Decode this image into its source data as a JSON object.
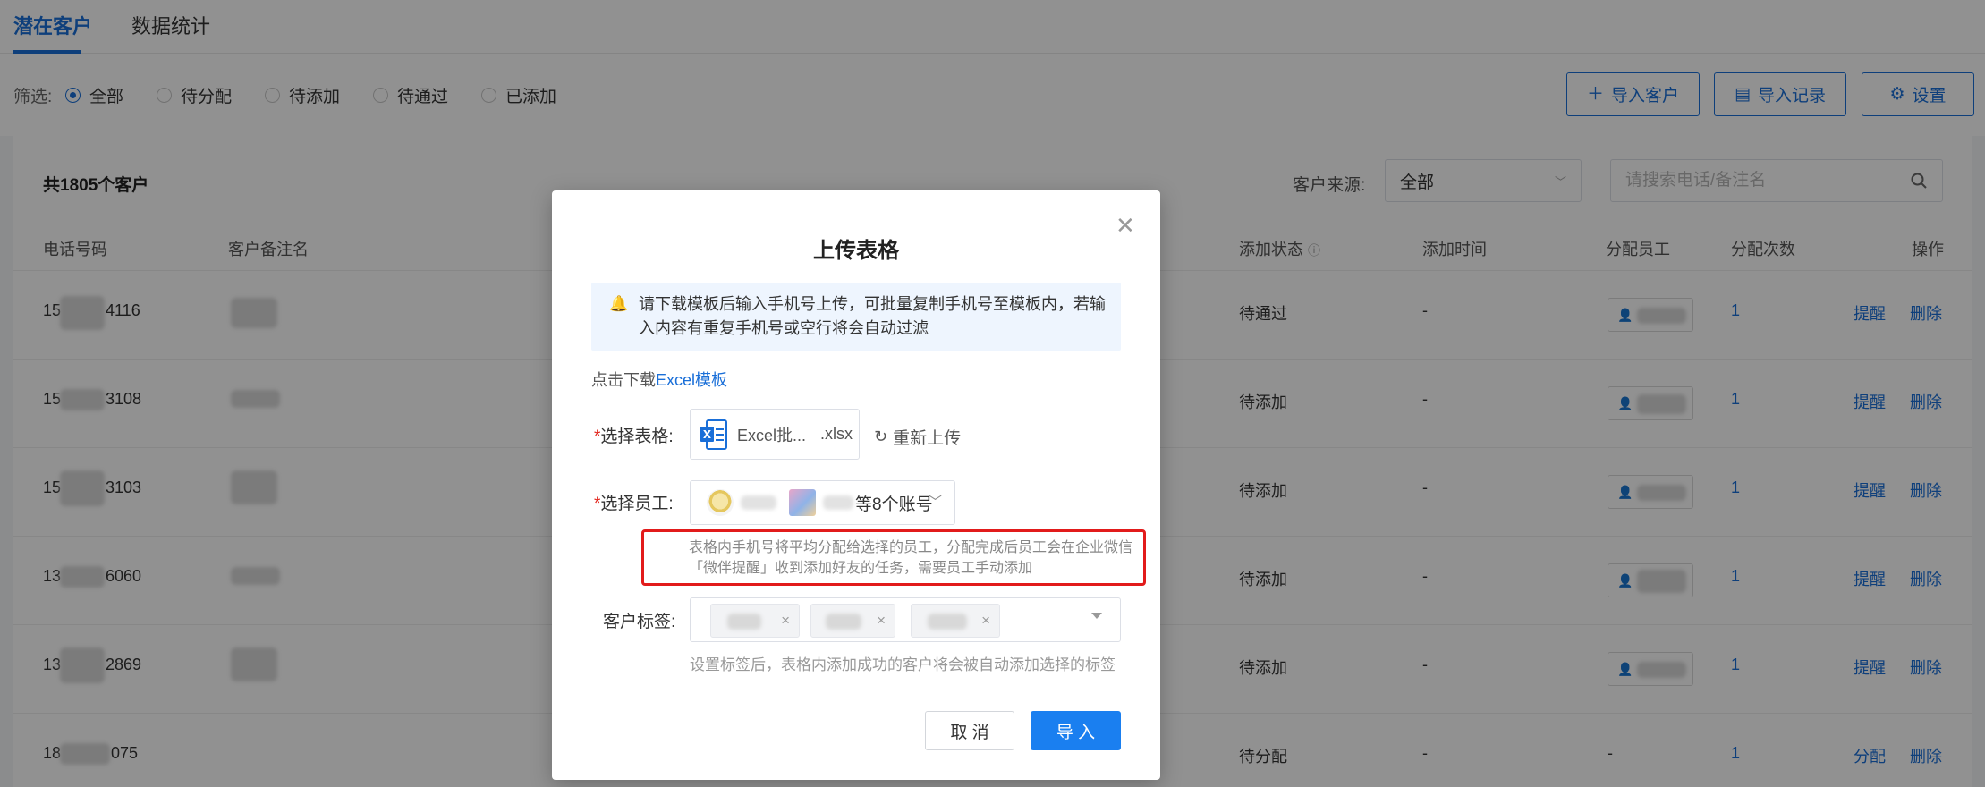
{
  "tabs": [
    {
      "label": "潜在客户",
      "active": true
    },
    {
      "label": "数据统计",
      "active": false
    }
  ],
  "filter": {
    "label": "筛选:",
    "options": [
      "全部",
      "待分配",
      "待添加",
      "待通过",
      "已添加"
    ],
    "selected": "全部"
  },
  "actions": {
    "import_customers": "导入客户",
    "import_records": "导入记录",
    "settings": "设置"
  },
  "list": {
    "count_text": "共1805个客户",
    "source_label": "客户来源:",
    "source_value": "全部",
    "search_placeholder": "请搜索电话/备注名"
  },
  "table": {
    "headers": {
      "phone": "电话号码",
      "remark": "客户备注名",
      "status": "添加状态",
      "time": "添加时间",
      "staff": "分配员工",
      "times": "分配次数",
      "ops": "操作"
    },
    "rows": [
      {
        "phone_head": "15",
        "phone_tail": "4116",
        "status": "待通过",
        "time": "-",
        "times": "1",
        "action": "提醒",
        "delete": "删除",
        "has_staff": true
      },
      {
        "phone_head": "15",
        "phone_tail": "3108",
        "status": "待添加",
        "time": "-",
        "times": "1",
        "action": "提醒",
        "delete": "删除",
        "has_staff": true
      },
      {
        "phone_head": "15",
        "phone_tail": "3103",
        "status": "待添加",
        "time": "-",
        "times": "1",
        "action": "提醒",
        "delete": "删除",
        "has_staff": true
      },
      {
        "phone_head": "13",
        "phone_tail": "6060",
        "status": "待添加",
        "time": "-",
        "times": "1",
        "action": "提醒",
        "delete": "删除",
        "has_staff": true
      },
      {
        "phone_head": "13",
        "phone_tail": "2869",
        "status": "待添加",
        "time": "-",
        "times": "1",
        "action": "提醒",
        "delete": "删除",
        "has_staff": true
      },
      {
        "phone_head": "18",
        "phone_tail": "075",
        "status": "待分配",
        "time": "-",
        "staff": "-",
        "times": "1",
        "action": "分配",
        "delete": "删除",
        "has_staff": false
      }
    ]
  },
  "modal": {
    "title": "上传表格",
    "notice": "请下载模板后输入手机号上传，可批量复制手机号至模板内，若输入内容有重复手机号或空行将会自动过滤",
    "download_prefix": "点击下载",
    "download_link": "Excel模板",
    "file_label": "选择表格:",
    "file_name": "Excel批...",
    "file_ext": ".xlsx",
    "reupload": "重新上传",
    "staff_label": "选择员工:",
    "staff_value": "等8个账号",
    "staff_hint": "表格内手机号将平均分配给选择的员工，分配完成后员工会在企业微信「微伴提醒」收到添加好友的任务，需要员工手动添加",
    "tag_label": "客户标签:",
    "tag_hint": "设置标签后，表格内添加成功的客户将会被自动添加选择的标签",
    "cancel": "取 消",
    "confirm": "导 入"
  },
  "colors": {
    "primary": "#1a6fd8",
    "confirm_button": "#1a7ff0",
    "highlight_border": "#e21b1b",
    "notice_bg": "#eef5fe"
  }
}
